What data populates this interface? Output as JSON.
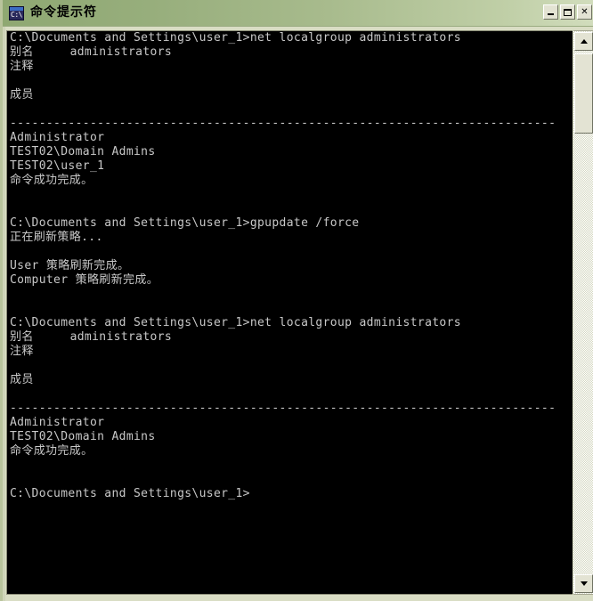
{
  "window": {
    "title": "命令提示符",
    "icon_name": "cmd-icon",
    "icon_text": "C:\\",
    "controls": {
      "minimize_label": "_",
      "maximize_label": "□",
      "close_label": "✕"
    }
  },
  "console": {
    "prompt": "C:\\Documents and Settings\\user_1>",
    "text": "C:\\Documents and Settings\\user_1>net localgroup administrators\n别名     administrators\n注释\n\n成员\n\n---------------------------------------------------------------------------\nAdministrator\nTEST02\\Domain Admins\nTEST02\\user_1\n命令成功完成。\n\n\nC:\\Documents and Settings\\user_1>gpupdate /force\n正在刷新策略...\n\nUser 策略刷新完成。\nComputer 策略刷新完成。\n\n\nC:\\Documents and Settings\\user_1>net localgroup administrators\n别名     administrators\n注释\n\n成员\n\n---------------------------------------------------------------------------\nAdministrator\nTEST02\\Domain Admins\n命令成功完成。\n\n\nC:\\Documents and Settings\\user_1>"
  },
  "scrollbar": {
    "up_arrow": "scroll-up-arrow-icon",
    "down_arrow": "scroll-down-arrow-icon"
  }
}
